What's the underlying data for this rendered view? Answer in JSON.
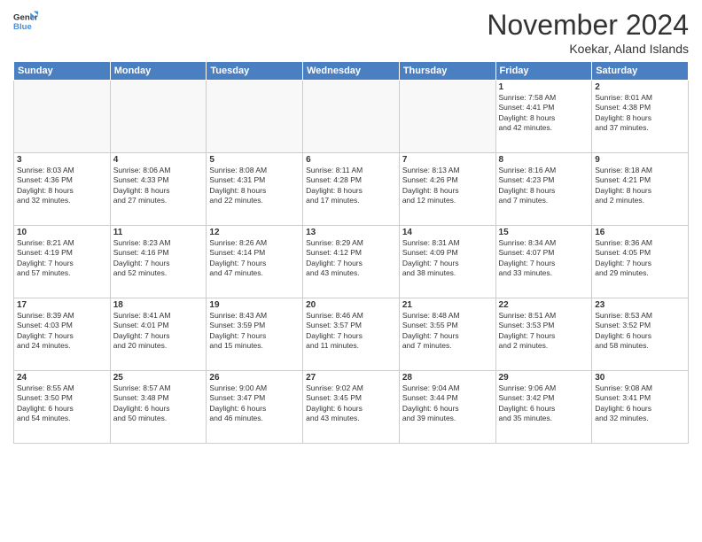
{
  "header": {
    "logo_line1": "General",
    "logo_line2": "Blue",
    "month_year": "November 2024",
    "location": "Koekar, Aland Islands"
  },
  "weekdays": [
    "Sunday",
    "Monday",
    "Tuesday",
    "Wednesday",
    "Thursday",
    "Friday",
    "Saturday"
  ],
  "weeks": [
    [
      {
        "day": "",
        "info": ""
      },
      {
        "day": "",
        "info": ""
      },
      {
        "day": "",
        "info": ""
      },
      {
        "day": "",
        "info": ""
      },
      {
        "day": "",
        "info": ""
      },
      {
        "day": "1",
        "info": "Sunrise: 7:58 AM\nSunset: 4:41 PM\nDaylight: 8 hours\nand 42 minutes."
      },
      {
        "day": "2",
        "info": "Sunrise: 8:01 AM\nSunset: 4:38 PM\nDaylight: 8 hours\nand 37 minutes."
      }
    ],
    [
      {
        "day": "3",
        "info": "Sunrise: 8:03 AM\nSunset: 4:36 PM\nDaylight: 8 hours\nand 32 minutes."
      },
      {
        "day": "4",
        "info": "Sunrise: 8:06 AM\nSunset: 4:33 PM\nDaylight: 8 hours\nand 27 minutes."
      },
      {
        "day": "5",
        "info": "Sunrise: 8:08 AM\nSunset: 4:31 PM\nDaylight: 8 hours\nand 22 minutes."
      },
      {
        "day": "6",
        "info": "Sunrise: 8:11 AM\nSunset: 4:28 PM\nDaylight: 8 hours\nand 17 minutes."
      },
      {
        "day": "7",
        "info": "Sunrise: 8:13 AM\nSunset: 4:26 PM\nDaylight: 8 hours\nand 12 minutes."
      },
      {
        "day": "8",
        "info": "Sunrise: 8:16 AM\nSunset: 4:23 PM\nDaylight: 8 hours\nand 7 minutes."
      },
      {
        "day": "9",
        "info": "Sunrise: 8:18 AM\nSunset: 4:21 PM\nDaylight: 8 hours\nand 2 minutes."
      }
    ],
    [
      {
        "day": "10",
        "info": "Sunrise: 8:21 AM\nSunset: 4:19 PM\nDaylight: 7 hours\nand 57 minutes."
      },
      {
        "day": "11",
        "info": "Sunrise: 8:23 AM\nSunset: 4:16 PM\nDaylight: 7 hours\nand 52 minutes."
      },
      {
        "day": "12",
        "info": "Sunrise: 8:26 AM\nSunset: 4:14 PM\nDaylight: 7 hours\nand 47 minutes."
      },
      {
        "day": "13",
        "info": "Sunrise: 8:29 AM\nSunset: 4:12 PM\nDaylight: 7 hours\nand 43 minutes."
      },
      {
        "day": "14",
        "info": "Sunrise: 8:31 AM\nSunset: 4:09 PM\nDaylight: 7 hours\nand 38 minutes."
      },
      {
        "day": "15",
        "info": "Sunrise: 8:34 AM\nSunset: 4:07 PM\nDaylight: 7 hours\nand 33 minutes."
      },
      {
        "day": "16",
        "info": "Sunrise: 8:36 AM\nSunset: 4:05 PM\nDaylight: 7 hours\nand 29 minutes."
      }
    ],
    [
      {
        "day": "17",
        "info": "Sunrise: 8:39 AM\nSunset: 4:03 PM\nDaylight: 7 hours\nand 24 minutes."
      },
      {
        "day": "18",
        "info": "Sunrise: 8:41 AM\nSunset: 4:01 PM\nDaylight: 7 hours\nand 20 minutes."
      },
      {
        "day": "19",
        "info": "Sunrise: 8:43 AM\nSunset: 3:59 PM\nDaylight: 7 hours\nand 15 minutes."
      },
      {
        "day": "20",
        "info": "Sunrise: 8:46 AM\nSunset: 3:57 PM\nDaylight: 7 hours\nand 11 minutes."
      },
      {
        "day": "21",
        "info": "Sunrise: 8:48 AM\nSunset: 3:55 PM\nDaylight: 7 hours\nand 7 minutes."
      },
      {
        "day": "22",
        "info": "Sunrise: 8:51 AM\nSunset: 3:53 PM\nDaylight: 7 hours\nand 2 minutes."
      },
      {
        "day": "23",
        "info": "Sunrise: 8:53 AM\nSunset: 3:52 PM\nDaylight: 6 hours\nand 58 minutes."
      }
    ],
    [
      {
        "day": "24",
        "info": "Sunrise: 8:55 AM\nSunset: 3:50 PM\nDaylight: 6 hours\nand 54 minutes."
      },
      {
        "day": "25",
        "info": "Sunrise: 8:57 AM\nSunset: 3:48 PM\nDaylight: 6 hours\nand 50 minutes."
      },
      {
        "day": "26",
        "info": "Sunrise: 9:00 AM\nSunset: 3:47 PM\nDaylight: 6 hours\nand 46 minutes."
      },
      {
        "day": "27",
        "info": "Sunrise: 9:02 AM\nSunset: 3:45 PM\nDaylight: 6 hours\nand 43 minutes."
      },
      {
        "day": "28",
        "info": "Sunrise: 9:04 AM\nSunset: 3:44 PM\nDaylight: 6 hours\nand 39 minutes."
      },
      {
        "day": "29",
        "info": "Sunrise: 9:06 AM\nSunset: 3:42 PM\nDaylight: 6 hours\nand 35 minutes."
      },
      {
        "day": "30",
        "info": "Sunrise: 9:08 AM\nSunset: 3:41 PM\nDaylight: 6 hours\nand 32 minutes."
      }
    ]
  ]
}
